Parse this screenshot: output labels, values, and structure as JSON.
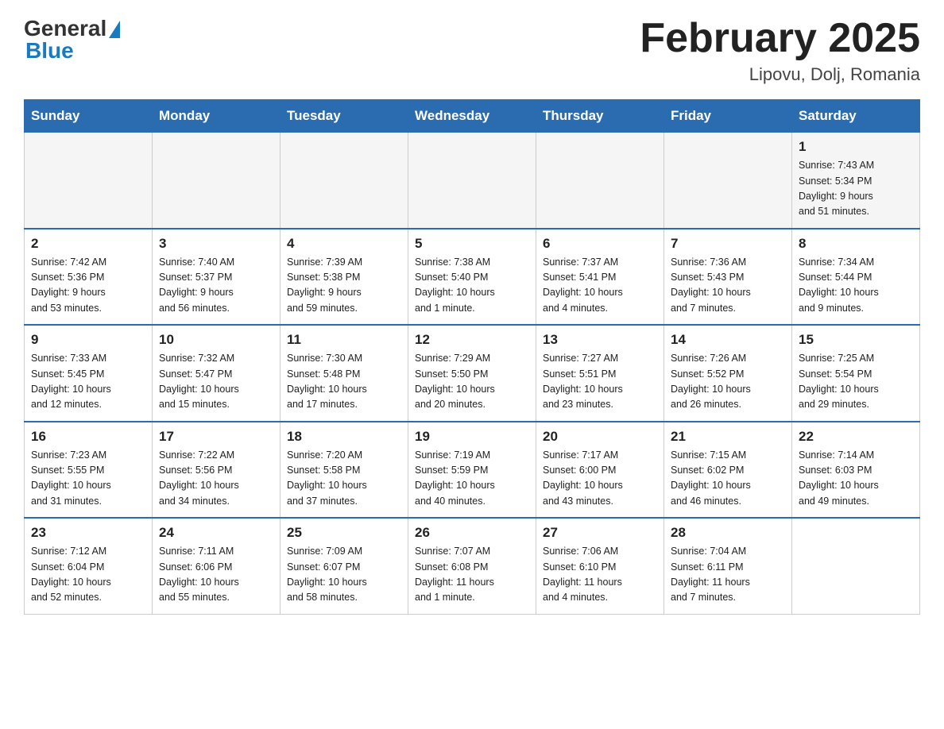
{
  "header": {
    "logo_general": "General",
    "logo_blue": "Blue",
    "title": "February 2025",
    "subtitle": "Lipovu, Dolj, Romania"
  },
  "weekdays": [
    "Sunday",
    "Monday",
    "Tuesday",
    "Wednesday",
    "Thursday",
    "Friday",
    "Saturday"
  ],
  "weeks": [
    [
      {
        "day": "",
        "info": ""
      },
      {
        "day": "",
        "info": ""
      },
      {
        "day": "",
        "info": ""
      },
      {
        "day": "",
        "info": ""
      },
      {
        "day": "",
        "info": ""
      },
      {
        "day": "",
        "info": ""
      },
      {
        "day": "1",
        "info": "Sunrise: 7:43 AM\nSunset: 5:34 PM\nDaylight: 9 hours\nand 51 minutes."
      }
    ],
    [
      {
        "day": "2",
        "info": "Sunrise: 7:42 AM\nSunset: 5:36 PM\nDaylight: 9 hours\nand 53 minutes."
      },
      {
        "day": "3",
        "info": "Sunrise: 7:40 AM\nSunset: 5:37 PM\nDaylight: 9 hours\nand 56 minutes."
      },
      {
        "day": "4",
        "info": "Sunrise: 7:39 AM\nSunset: 5:38 PM\nDaylight: 9 hours\nand 59 minutes."
      },
      {
        "day": "5",
        "info": "Sunrise: 7:38 AM\nSunset: 5:40 PM\nDaylight: 10 hours\nand 1 minute."
      },
      {
        "day": "6",
        "info": "Sunrise: 7:37 AM\nSunset: 5:41 PM\nDaylight: 10 hours\nand 4 minutes."
      },
      {
        "day": "7",
        "info": "Sunrise: 7:36 AM\nSunset: 5:43 PM\nDaylight: 10 hours\nand 7 minutes."
      },
      {
        "day": "8",
        "info": "Sunrise: 7:34 AM\nSunset: 5:44 PM\nDaylight: 10 hours\nand 9 minutes."
      }
    ],
    [
      {
        "day": "9",
        "info": "Sunrise: 7:33 AM\nSunset: 5:45 PM\nDaylight: 10 hours\nand 12 minutes."
      },
      {
        "day": "10",
        "info": "Sunrise: 7:32 AM\nSunset: 5:47 PM\nDaylight: 10 hours\nand 15 minutes."
      },
      {
        "day": "11",
        "info": "Sunrise: 7:30 AM\nSunset: 5:48 PM\nDaylight: 10 hours\nand 17 minutes."
      },
      {
        "day": "12",
        "info": "Sunrise: 7:29 AM\nSunset: 5:50 PM\nDaylight: 10 hours\nand 20 minutes."
      },
      {
        "day": "13",
        "info": "Sunrise: 7:27 AM\nSunset: 5:51 PM\nDaylight: 10 hours\nand 23 minutes."
      },
      {
        "day": "14",
        "info": "Sunrise: 7:26 AM\nSunset: 5:52 PM\nDaylight: 10 hours\nand 26 minutes."
      },
      {
        "day": "15",
        "info": "Sunrise: 7:25 AM\nSunset: 5:54 PM\nDaylight: 10 hours\nand 29 minutes."
      }
    ],
    [
      {
        "day": "16",
        "info": "Sunrise: 7:23 AM\nSunset: 5:55 PM\nDaylight: 10 hours\nand 31 minutes."
      },
      {
        "day": "17",
        "info": "Sunrise: 7:22 AM\nSunset: 5:56 PM\nDaylight: 10 hours\nand 34 minutes."
      },
      {
        "day": "18",
        "info": "Sunrise: 7:20 AM\nSunset: 5:58 PM\nDaylight: 10 hours\nand 37 minutes."
      },
      {
        "day": "19",
        "info": "Sunrise: 7:19 AM\nSunset: 5:59 PM\nDaylight: 10 hours\nand 40 minutes."
      },
      {
        "day": "20",
        "info": "Sunrise: 7:17 AM\nSunset: 6:00 PM\nDaylight: 10 hours\nand 43 minutes."
      },
      {
        "day": "21",
        "info": "Sunrise: 7:15 AM\nSunset: 6:02 PM\nDaylight: 10 hours\nand 46 minutes."
      },
      {
        "day": "22",
        "info": "Sunrise: 7:14 AM\nSunset: 6:03 PM\nDaylight: 10 hours\nand 49 minutes."
      }
    ],
    [
      {
        "day": "23",
        "info": "Sunrise: 7:12 AM\nSunset: 6:04 PM\nDaylight: 10 hours\nand 52 minutes."
      },
      {
        "day": "24",
        "info": "Sunrise: 7:11 AM\nSunset: 6:06 PM\nDaylight: 10 hours\nand 55 minutes."
      },
      {
        "day": "25",
        "info": "Sunrise: 7:09 AM\nSunset: 6:07 PM\nDaylight: 10 hours\nand 58 minutes."
      },
      {
        "day": "26",
        "info": "Sunrise: 7:07 AM\nSunset: 6:08 PM\nDaylight: 11 hours\nand 1 minute."
      },
      {
        "day": "27",
        "info": "Sunrise: 7:06 AM\nSunset: 6:10 PM\nDaylight: 11 hours\nand 4 minutes."
      },
      {
        "day": "28",
        "info": "Sunrise: 7:04 AM\nSunset: 6:11 PM\nDaylight: 11 hours\nand 7 minutes."
      },
      {
        "day": "",
        "info": ""
      }
    ]
  ]
}
